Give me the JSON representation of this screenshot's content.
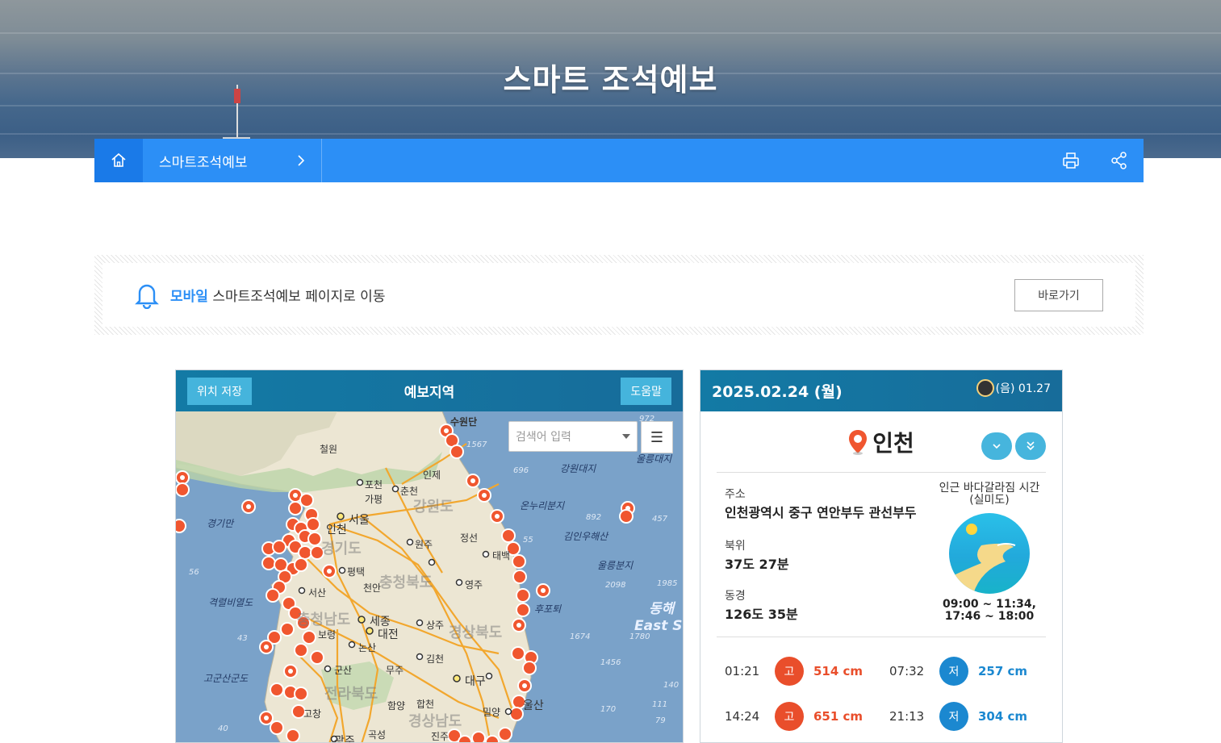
{
  "hero": {
    "title": "스마트 조석예보"
  },
  "breadcrumb": {
    "home_icon": "home-icon",
    "current": "스마트조석예보",
    "print_icon": "print-icon",
    "share_icon": "share-icon"
  },
  "notice": {
    "highlight": "모바일",
    "text": "스마트조석예보 페이지로 이동",
    "button": "바로가기"
  },
  "map": {
    "save_button": "위치 저장",
    "title": "예보지역",
    "help_button": "도움말",
    "search_placeholder": "검색어 입력",
    "labels": [
      "철원",
      "포천",
      "가평",
      "춘천",
      "인제",
      "수원단",
      "강원대지",
      "온누리분지",
      "김인우해산",
      "울릉분지",
      "울릉대지",
      "서울",
      "인천",
      "원주",
      "정선",
      "태백",
      "경기만",
      "평택",
      "천안",
      "영주",
      "서산",
      "후포퇴",
      "격렬비열도",
      "세종",
      "대전",
      "보령",
      "상주",
      "논산",
      "동해",
      "East Sea",
      "김천",
      "군산",
      "무주",
      "대구",
      "고군산군도",
      "밀양",
      "합천",
      "함양",
      "고창",
      "곡성",
      "광주",
      "진주",
      "울산",
      "강원도",
      "경기도",
      "충청북도",
      "충청남도",
      "경상북도",
      "전라북도",
      "경상남도"
    ],
    "depths": [
      "1567",
      "696",
      "892",
      "457",
      "55",
      "1985",
      "2098",
      "1674",
      "1780",
      "1456",
      "140",
      "111",
      "170",
      "79",
      "56",
      "43",
      "40",
      "972"
    ]
  },
  "tide": {
    "date": "2025.02.24 (월)",
    "lunar": "(음) 01.27",
    "location": "인천",
    "address_label": "주소",
    "address": "인천광역시 중구 연안부두 관선부두",
    "lat_label": "북위",
    "lat": "37도 27분",
    "lon_label": "동경",
    "lon": "126도 35분",
    "sea_part_label": "인근 바다갈라짐 시간",
    "sea_part_place": "(실미도)",
    "sea_part_times_1": "09:00 ~ 11:34,",
    "sea_part_times_2": "17:46 ~ 18:00",
    "rows": [
      {
        "t1": "01:21",
        "k1": "고",
        "v1": "514 cm",
        "t2": "07:32",
        "k2": "저",
        "v2": "257 cm"
      },
      {
        "t1": "14:24",
        "k1": "고",
        "v1": "651 cm",
        "t2": "21:13",
        "k2": "저",
        "v2": "304 cm"
      }
    ],
    "colors": {
      "high": "#e94e2b",
      "low": "#1b88d0"
    }
  }
}
